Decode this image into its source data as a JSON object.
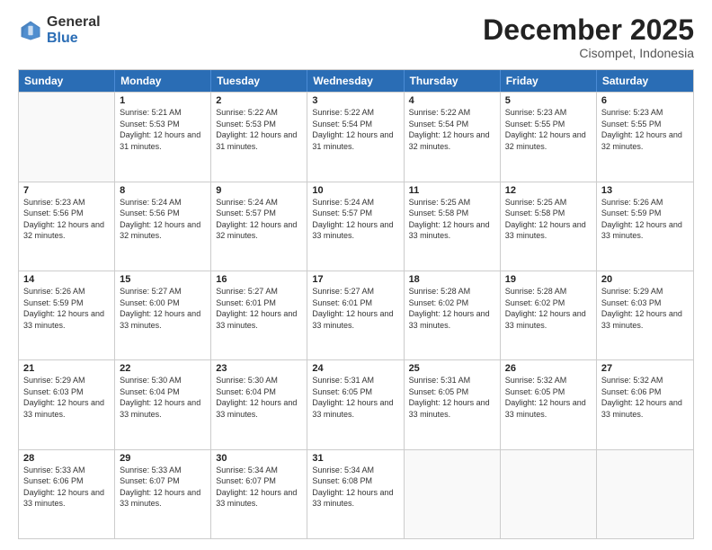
{
  "logo": {
    "general": "General",
    "blue": "Blue"
  },
  "title": "December 2025",
  "subtitle": "Cisompet, Indonesia",
  "header_days": [
    "Sunday",
    "Monday",
    "Tuesday",
    "Wednesday",
    "Thursday",
    "Friday",
    "Saturday"
  ],
  "weeks": [
    [
      {
        "day": "",
        "sunrise": "",
        "sunset": "",
        "daylight": ""
      },
      {
        "day": "1",
        "sunrise": "Sunrise: 5:21 AM",
        "sunset": "Sunset: 5:53 PM",
        "daylight": "Daylight: 12 hours and 31 minutes."
      },
      {
        "day": "2",
        "sunrise": "Sunrise: 5:22 AM",
        "sunset": "Sunset: 5:53 PM",
        "daylight": "Daylight: 12 hours and 31 minutes."
      },
      {
        "day": "3",
        "sunrise": "Sunrise: 5:22 AM",
        "sunset": "Sunset: 5:54 PM",
        "daylight": "Daylight: 12 hours and 31 minutes."
      },
      {
        "day": "4",
        "sunrise": "Sunrise: 5:22 AM",
        "sunset": "Sunset: 5:54 PM",
        "daylight": "Daylight: 12 hours and 32 minutes."
      },
      {
        "day": "5",
        "sunrise": "Sunrise: 5:23 AM",
        "sunset": "Sunset: 5:55 PM",
        "daylight": "Daylight: 12 hours and 32 minutes."
      },
      {
        "day": "6",
        "sunrise": "Sunrise: 5:23 AM",
        "sunset": "Sunset: 5:55 PM",
        "daylight": "Daylight: 12 hours and 32 minutes."
      }
    ],
    [
      {
        "day": "7",
        "sunrise": "Sunrise: 5:23 AM",
        "sunset": "Sunset: 5:56 PM",
        "daylight": "Daylight: 12 hours and 32 minutes."
      },
      {
        "day": "8",
        "sunrise": "Sunrise: 5:24 AM",
        "sunset": "Sunset: 5:56 PM",
        "daylight": "Daylight: 12 hours and 32 minutes."
      },
      {
        "day": "9",
        "sunrise": "Sunrise: 5:24 AM",
        "sunset": "Sunset: 5:57 PM",
        "daylight": "Daylight: 12 hours and 32 minutes."
      },
      {
        "day": "10",
        "sunrise": "Sunrise: 5:24 AM",
        "sunset": "Sunset: 5:57 PM",
        "daylight": "Daylight: 12 hours and 33 minutes."
      },
      {
        "day": "11",
        "sunrise": "Sunrise: 5:25 AM",
        "sunset": "Sunset: 5:58 PM",
        "daylight": "Daylight: 12 hours and 33 minutes."
      },
      {
        "day": "12",
        "sunrise": "Sunrise: 5:25 AM",
        "sunset": "Sunset: 5:58 PM",
        "daylight": "Daylight: 12 hours and 33 minutes."
      },
      {
        "day": "13",
        "sunrise": "Sunrise: 5:26 AM",
        "sunset": "Sunset: 5:59 PM",
        "daylight": "Daylight: 12 hours and 33 minutes."
      }
    ],
    [
      {
        "day": "14",
        "sunrise": "Sunrise: 5:26 AM",
        "sunset": "Sunset: 5:59 PM",
        "daylight": "Daylight: 12 hours and 33 minutes."
      },
      {
        "day": "15",
        "sunrise": "Sunrise: 5:27 AM",
        "sunset": "Sunset: 6:00 PM",
        "daylight": "Daylight: 12 hours and 33 minutes."
      },
      {
        "day": "16",
        "sunrise": "Sunrise: 5:27 AM",
        "sunset": "Sunset: 6:01 PM",
        "daylight": "Daylight: 12 hours and 33 minutes."
      },
      {
        "day": "17",
        "sunrise": "Sunrise: 5:27 AM",
        "sunset": "Sunset: 6:01 PM",
        "daylight": "Daylight: 12 hours and 33 minutes."
      },
      {
        "day": "18",
        "sunrise": "Sunrise: 5:28 AM",
        "sunset": "Sunset: 6:02 PM",
        "daylight": "Daylight: 12 hours and 33 minutes."
      },
      {
        "day": "19",
        "sunrise": "Sunrise: 5:28 AM",
        "sunset": "Sunset: 6:02 PM",
        "daylight": "Daylight: 12 hours and 33 minutes."
      },
      {
        "day": "20",
        "sunrise": "Sunrise: 5:29 AM",
        "sunset": "Sunset: 6:03 PM",
        "daylight": "Daylight: 12 hours and 33 minutes."
      }
    ],
    [
      {
        "day": "21",
        "sunrise": "Sunrise: 5:29 AM",
        "sunset": "Sunset: 6:03 PM",
        "daylight": "Daylight: 12 hours and 33 minutes."
      },
      {
        "day": "22",
        "sunrise": "Sunrise: 5:30 AM",
        "sunset": "Sunset: 6:04 PM",
        "daylight": "Daylight: 12 hours and 33 minutes."
      },
      {
        "day": "23",
        "sunrise": "Sunrise: 5:30 AM",
        "sunset": "Sunset: 6:04 PM",
        "daylight": "Daylight: 12 hours and 33 minutes."
      },
      {
        "day": "24",
        "sunrise": "Sunrise: 5:31 AM",
        "sunset": "Sunset: 6:05 PM",
        "daylight": "Daylight: 12 hours and 33 minutes."
      },
      {
        "day": "25",
        "sunrise": "Sunrise: 5:31 AM",
        "sunset": "Sunset: 6:05 PM",
        "daylight": "Daylight: 12 hours and 33 minutes."
      },
      {
        "day": "26",
        "sunrise": "Sunrise: 5:32 AM",
        "sunset": "Sunset: 6:05 PM",
        "daylight": "Daylight: 12 hours and 33 minutes."
      },
      {
        "day": "27",
        "sunrise": "Sunrise: 5:32 AM",
        "sunset": "Sunset: 6:06 PM",
        "daylight": "Daylight: 12 hours and 33 minutes."
      }
    ],
    [
      {
        "day": "28",
        "sunrise": "Sunrise: 5:33 AM",
        "sunset": "Sunset: 6:06 PM",
        "daylight": "Daylight: 12 hours and 33 minutes."
      },
      {
        "day": "29",
        "sunrise": "Sunrise: 5:33 AM",
        "sunset": "Sunset: 6:07 PM",
        "daylight": "Daylight: 12 hours and 33 minutes."
      },
      {
        "day": "30",
        "sunrise": "Sunrise: 5:34 AM",
        "sunset": "Sunset: 6:07 PM",
        "daylight": "Daylight: 12 hours and 33 minutes."
      },
      {
        "day": "31",
        "sunrise": "Sunrise: 5:34 AM",
        "sunset": "Sunset: 6:08 PM",
        "daylight": "Daylight: 12 hours and 33 minutes."
      },
      {
        "day": "",
        "sunrise": "",
        "sunset": "",
        "daylight": ""
      },
      {
        "day": "",
        "sunrise": "",
        "sunset": "",
        "daylight": ""
      },
      {
        "day": "",
        "sunrise": "",
        "sunset": "",
        "daylight": ""
      }
    ]
  ]
}
